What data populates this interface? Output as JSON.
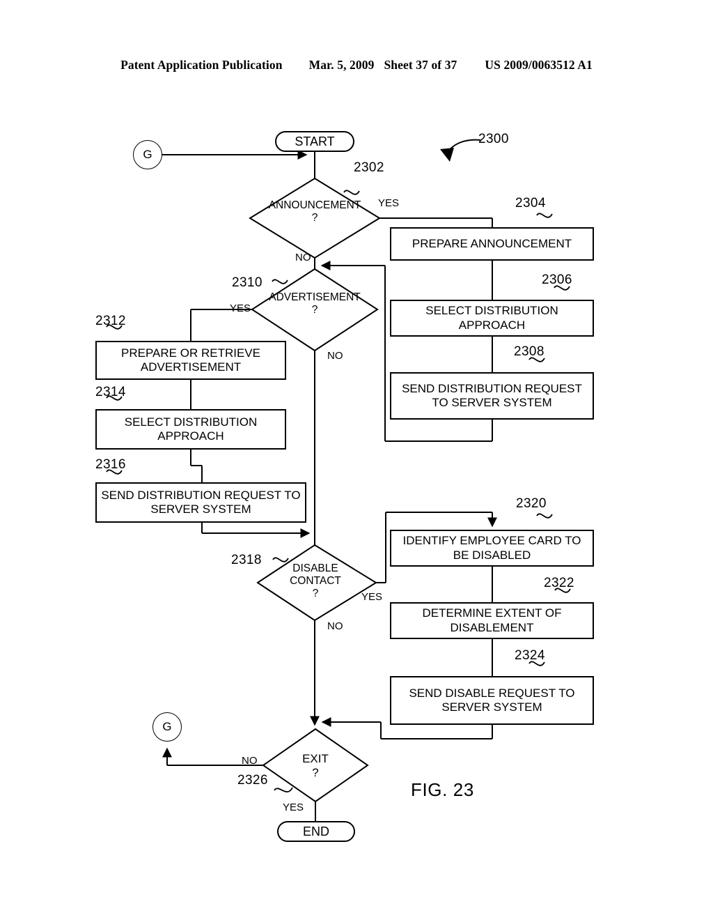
{
  "header": {
    "publication": "Patent Application Publication",
    "date": "Mar. 5, 2009",
    "sheet": "Sheet 37 of 37",
    "number": "US 2009/0063512 A1"
  },
  "figure": {
    "label": "FIG. 23",
    "diagram_ref": "2300"
  },
  "connectors": {
    "top_g": "G",
    "bottom_g": "G"
  },
  "terminals": {
    "start": "START",
    "end": "END"
  },
  "decisions": [
    {
      "id": "2302",
      "ref": "2302",
      "line1": "ANNOUNCEMENT",
      "line2": "?",
      "yes": "YES",
      "no": "NO"
    },
    {
      "id": "2310",
      "ref": "2310",
      "line1": "ADVERTISEMENT",
      "line2": "?",
      "yes": "YES",
      "no": "NO"
    },
    {
      "id": "2318",
      "ref": "2318",
      "line1": "DISABLE",
      "line2": "CONTACT",
      "line3": "?",
      "yes": "YES",
      "no": "NO"
    },
    {
      "id": "2326",
      "ref": "2326",
      "line1": "EXIT",
      "line2": "?",
      "yes": "YES",
      "no": "NO"
    }
  ],
  "processes": [
    {
      "id": "2304",
      "ref": "2304",
      "text": "PREPARE ANNOUNCEMENT"
    },
    {
      "id": "2306",
      "ref": "2306",
      "text": "SELECT DISTRIBUTION APPROACH"
    },
    {
      "id": "2308",
      "ref": "2308",
      "text": "SEND DISTRIBUTION REQUEST TO SERVER SYSTEM"
    },
    {
      "id": "2312",
      "ref": "2312",
      "text": "PREPARE OR RETRIEVE ADVERTISEMENT"
    },
    {
      "id": "2314",
      "ref": "2314",
      "text": "SELECT DISTRIBUTION APPROACH"
    },
    {
      "id": "2316",
      "ref": "2316",
      "text": "SEND DISTRIBUTION REQUEST TO SERVER SYSTEM"
    },
    {
      "id": "2320",
      "ref": "2320",
      "text": "IDENTIFY EMPLOYEE CARD TO BE DISABLED"
    },
    {
      "id": "2322",
      "ref": "2322",
      "text": "DETERMINE EXTENT OF DISABLEMENT"
    },
    {
      "id": "2324",
      "ref": "2324",
      "text": "SEND DISABLE REQUEST TO SERVER SYSTEM"
    }
  ],
  "colors": {
    "ink": "#000000",
    "paper": "#ffffff"
  }
}
